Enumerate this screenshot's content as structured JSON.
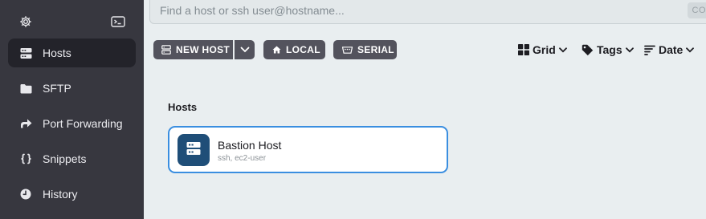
{
  "sidebar": {
    "top_icons": [
      "gear-icon",
      "terminal-icon"
    ],
    "items": [
      {
        "label": "Hosts",
        "icon": "server-icon",
        "active": true
      },
      {
        "label": "SFTP",
        "icon": "folder-icon",
        "active": false
      },
      {
        "label": "Port Forwarding",
        "icon": "forward-arrow-icon",
        "active": false
      },
      {
        "label": "Snippets",
        "icon": "braces-icon",
        "active": false
      },
      {
        "label": "History",
        "icon": "clock-icon",
        "active": false
      }
    ]
  },
  "search": {
    "placeholder": "Find a host or ssh user@hostname...",
    "value": "",
    "connect_label": "CO"
  },
  "toolbar": {
    "new_host_label": "NEW HOST",
    "local_label": "LOCAL",
    "serial_label": "SERIAL",
    "view_label": "Grid",
    "tags_label": "Tags",
    "sort_label": "Date"
  },
  "hosts_section": {
    "title": "Hosts",
    "items": [
      {
        "name": "Bastion Host",
        "subtitle": "ssh, ec2-user",
        "icon": "server-icon"
      }
    ]
  },
  "colors": {
    "sidebar_bg": "#37373f",
    "sidebar_active_bg": "#23232a",
    "main_bg": "#e9eef0",
    "button_bg": "#53535d",
    "card_border": "#3a8ee0",
    "host_avatar_bg": "#1f4e78"
  }
}
